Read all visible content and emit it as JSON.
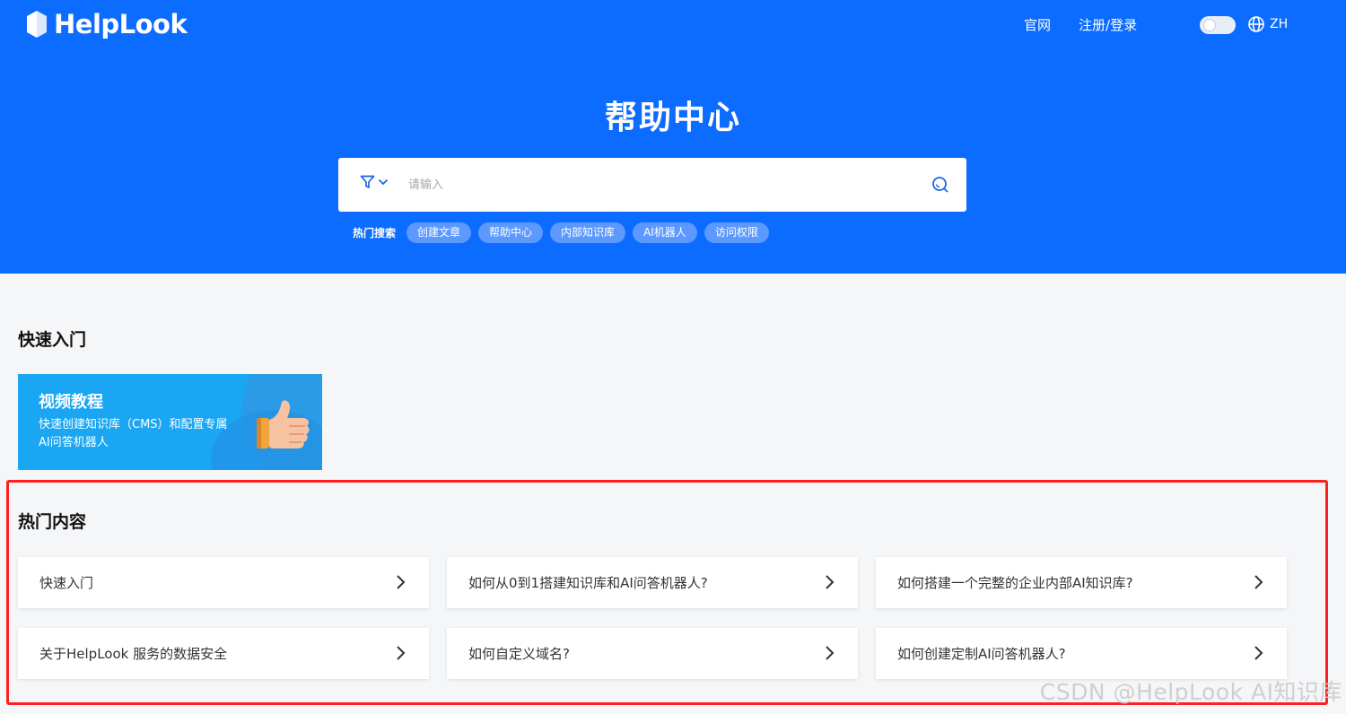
{
  "header": {
    "logo_text": "HelpLook",
    "nav": [
      "官网",
      "注册/登录"
    ],
    "language": "ZH"
  },
  "hero": {
    "title": "帮助中心",
    "search_placeholder": "请输入",
    "hot_search_label": "热门搜索",
    "hot_tags": [
      "创建文章",
      "帮助中心",
      "内部知识库",
      "AI机器人",
      "访问权限"
    ]
  },
  "quick_start": {
    "title": "快速入门",
    "video_card": {
      "title": "视频教程",
      "description": "快速创建知识库（CMS）和配置专属AI问答机器人"
    }
  },
  "hot_content": {
    "title": "热门内容",
    "items": [
      "快速入门",
      "如何从0到1搭建知识库和AI问答机器人?",
      "如何搭建一个完整的企业内部AI知识库?",
      "关于HelpLook 服务的数据安全",
      "如何自定义域名?",
      "如何创建定制AI问答机器人?"
    ]
  },
  "watermark": "CSDN @HelpLook AI知识库",
  "colors": {
    "brand_blue": "#0c6cff",
    "tag_bg": "#5c99ff",
    "video_card_bg": "#1aa6f3",
    "highlight_border": "#ff1f1f"
  }
}
